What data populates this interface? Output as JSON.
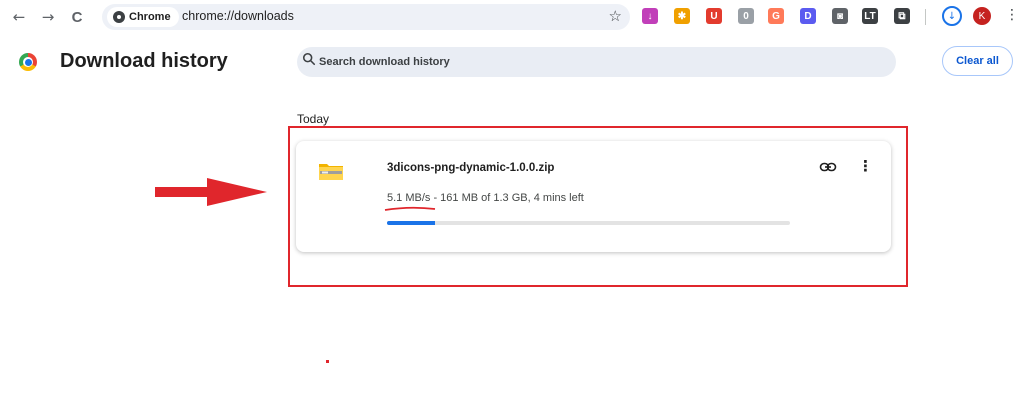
{
  "toolbar": {
    "back": "←",
    "forward": "→",
    "reload": "C",
    "chip_label": "Chrome",
    "url": "chrome://downloads",
    "bookmark": "☆",
    "extensions": [
      {
        "name": "extension-download-icon",
        "glyph": "↓",
        "color": "#c13fb9"
      },
      {
        "name": "extension-colorful-icon",
        "glyph": "✱",
        "color": "#f0a000"
      },
      {
        "name": "extension-u-icon",
        "glyph": "U",
        "color": "#e33b2e"
      },
      {
        "name": "extension-capsule-icon",
        "glyph": "0",
        "color": "#9aa0a6"
      },
      {
        "name": "extension-g-icon",
        "glyph": "G",
        "color": "#ff7a59"
      },
      {
        "name": "extension-d-icon",
        "glyph": "D",
        "color": "#5b5bf0"
      },
      {
        "name": "extension-camera-icon",
        "glyph": "◙",
        "color": "#5f6368"
      },
      {
        "name": "extension-lt-icon",
        "glyph": "LT",
        "color": "#3c4043"
      },
      {
        "name": "extensions-puzzle-icon",
        "glyph": "⧉",
        "color": "#3c4043"
      }
    ],
    "download_indicator": "↓",
    "avatar_letter": "K",
    "menu": "⋮"
  },
  "page": {
    "title": "Download history",
    "search_placeholder": "Search download history",
    "clear_all": "Clear all"
  },
  "downloads": {
    "section_label": "Today",
    "item": {
      "file_name": "3dicons-png-dynamic-1.0.0.zip",
      "speed": "5.1 MB/s",
      "status_rest": " - 161 MB of 1.3 GB, 4 mins left",
      "progress_percent": 12,
      "more": "⋮"
    }
  },
  "colors": {
    "accent": "#1a73e8",
    "annotation_red": "#e0262c"
  }
}
